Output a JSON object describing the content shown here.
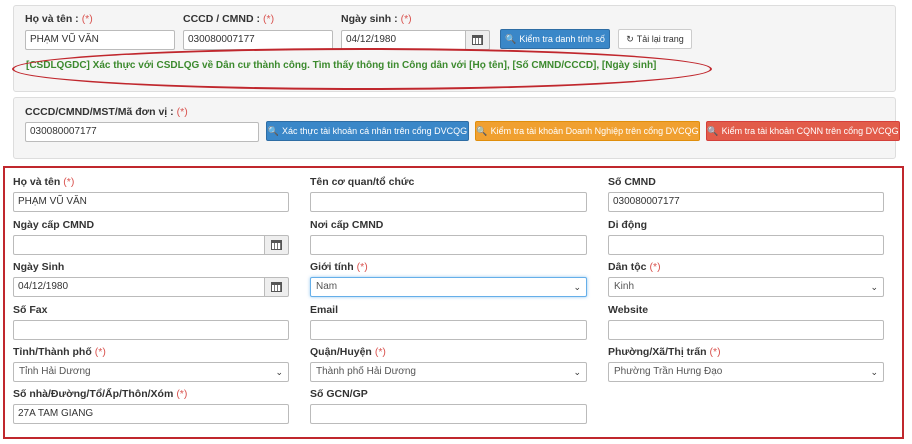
{
  "lookup_panel": {
    "name_label": "Họ và tên :",
    "id_label": "CCCD / CMND :",
    "dob_label": "Ngày sinh :",
    "required_mark": "(*)",
    "name_value": "PHẠM VŨ VĂN",
    "id_value": "030080007177",
    "dob_value": "04/12/1980",
    "verify_button": "Kiểm tra danh tính số",
    "reload_button": "Tải lại trang",
    "result_message": "[CSDLQGDC] Xác thực với CSDLQG về Dân cư thành công. Tìm thấy thông tin Công dân với [Họ tên], [Số CMND/CCCD], [Ngày sinh]"
  },
  "account_panel": {
    "id_label": "CCCD/CMND/MST/Mã đơn vị :",
    "required_mark": "(*)",
    "id_value": "030080007177",
    "btn_personal": "Xác thực tài khoản cá nhân trên cổng DVCQG",
    "btn_business": "Kiểm tra tài khoản Doanh Nghiệp trên cổng DVCQG",
    "btn_cqnn": "Kiểm tra tài khoản CQNN trên cổng DVCQG"
  },
  "form": {
    "required_mark": "(*)",
    "ho_ten": {
      "label": "Họ và tên",
      "value": "PHẠM VŨ VĂN"
    },
    "co_quan": {
      "label": "Tên cơ quan/tổ chức",
      "value": ""
    },
    "so_cmnd": {
      "label": "Số CMND",
      "value": "030080007177"
    },
    "ngay_cap": {
      "label": "Ngày cấp CMND",
      "value": ""
    },
    "noi_cap": {
      "label": "Nơi cấp CMND",
      "value": ""
    },
    "di_dong": {
      "label": "Di động",
      "value": ""
    },
    "ngay_sinh": {
      "label": "Ngày Sinh",
      "value": "04/12/1980"
    },
    "gioi_tinh": {
      "label": "Giới tính",
      "value": "Nam"
    },
    "dan_toc": {
      "label": "Dân tộc",
      "value": "Kinh"
    },
    "so_fax": {
      "label": "Số Fax",
      "value": ""
    },
    "email": {
      "label": "Email",
      "value": ""
    },
    "website": {
      "label": "Website",
      "value": ""
    },
    "tinh": {
      "label": "Tỉnh/Thành phố",
      "value": "Tỉnh Hải Dương"
    },
    "quan": {
      "label": "Quận/Huyện",
      "value": "Thành phố Hải Dương"
    },
    "phuong": {
      "label": "Phường/Xã/Thị trấn",
      "value": "Phường Trần Hưng Đạo"
    },
    "dia_chi": {
      "label": "Số nhà/Đường/Tổ/Ấp/Thôn/Xóm",
      "value": "27A TAM GIANG"
    },
    "so_gcn": {
      "label": "Số GCN/GP",
      "value": ""
    }
  },
  "colors": {
    "accent_blue": "#3a87c8",
    "orange": "#f0a030",
    "red": "#e25c4a",
    "success_text": "#3c8a2e",
    "highlight": "#c0272d",
    "required": "#d9534f"
  },
  "icons": {
    "search": "search-icon",
    "refresh": "refresh-icon",
    "calendar": "calendar-icon",
    "select": "chevron-down-icon"
  }
}
